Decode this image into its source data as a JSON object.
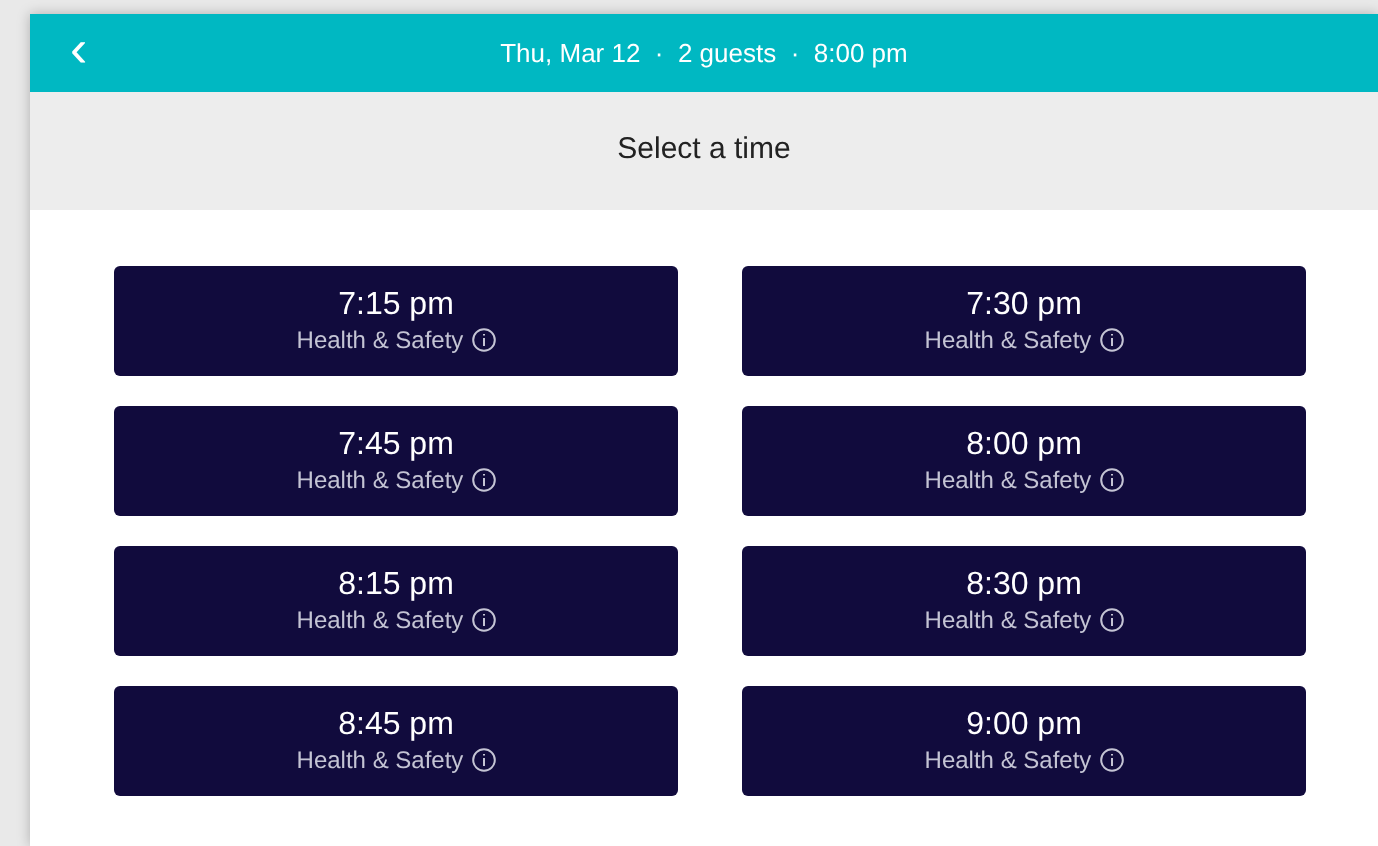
{
  "header": {
    "back": "‹",
    "summary": "Thu, Mar 12  ·  2 guests  ·  8:00 pm"
  },
  "title": "Select a time",
  "slots": [
    {
      "time": "7:15 pm",
      "note": "Health & Safety"
    },
    {
      "time": "7:30 pm",
      "note": "Health & Safety"
    },
    {
      "time": "7:45 pm",
      "note": "Health & Safety"
    },
    {
      "time": "8:00 pm",
      "note": "Health & Safety"
    },
    {
      "time": "8:15 pm",
      "note": "Health & Safety"
    },
    {
      "time": "8:30 pm",
      "note": "Health & Safety"
    },
    {
      "time": "8:45 pm",
      "note": "Health & Safety"
    },
    {
      "time": "9:00 pm",
      "note": "Health & Safety"
    }
  ]
}
